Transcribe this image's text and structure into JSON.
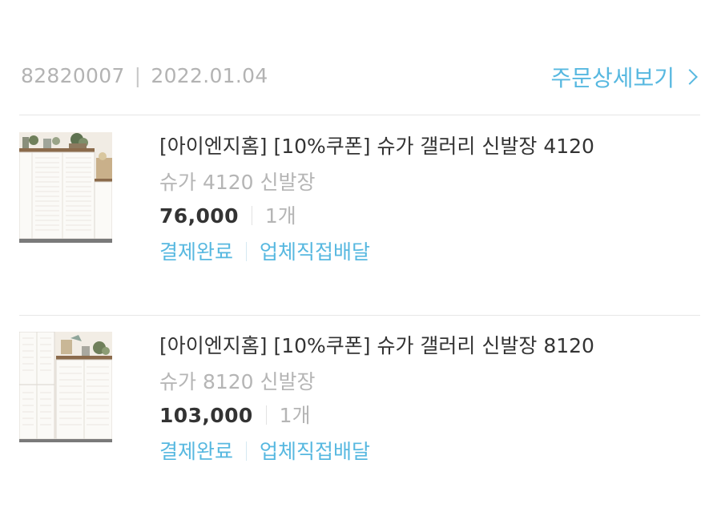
{
  "order": {
    "number": "82820007",
    "separator": "|",
    "date": "2022.01.04",
    "detail_link": "주문상세보기"
  },
  "products": [
    {
      "title": "[아이엔지홈] [10%쿠폰]  슈가 갤러리 신발장 4120",
      "option": "슈가 4120 신발장",
      "price": "76,000",
      "quantity": "1개",
      "status": "결제완료",
      "delivery": "업체직접배달",
      "thumbnail_icon": "shoe-cabinet-4120-image"
    },
    {
      "title": "[아이엔지홈] [10%쿠폰]  슈가 갤러리 신발장 8120",
      "option": "슈가 8120 신발장",
      "price": "103,000",
      "quantity": "1개",
      "status": "결제완료",
      "delivery": "업체직접배달",
      "thumbnail_icon": "shoe-cabinet-8120-image"
    }
  ],
  "colors": {
    "accent": "#57b8e0",
    "muted": "#b5b5b5",
    "text": "#333333",
    "divider": "#e6e6e6"
  }
}
